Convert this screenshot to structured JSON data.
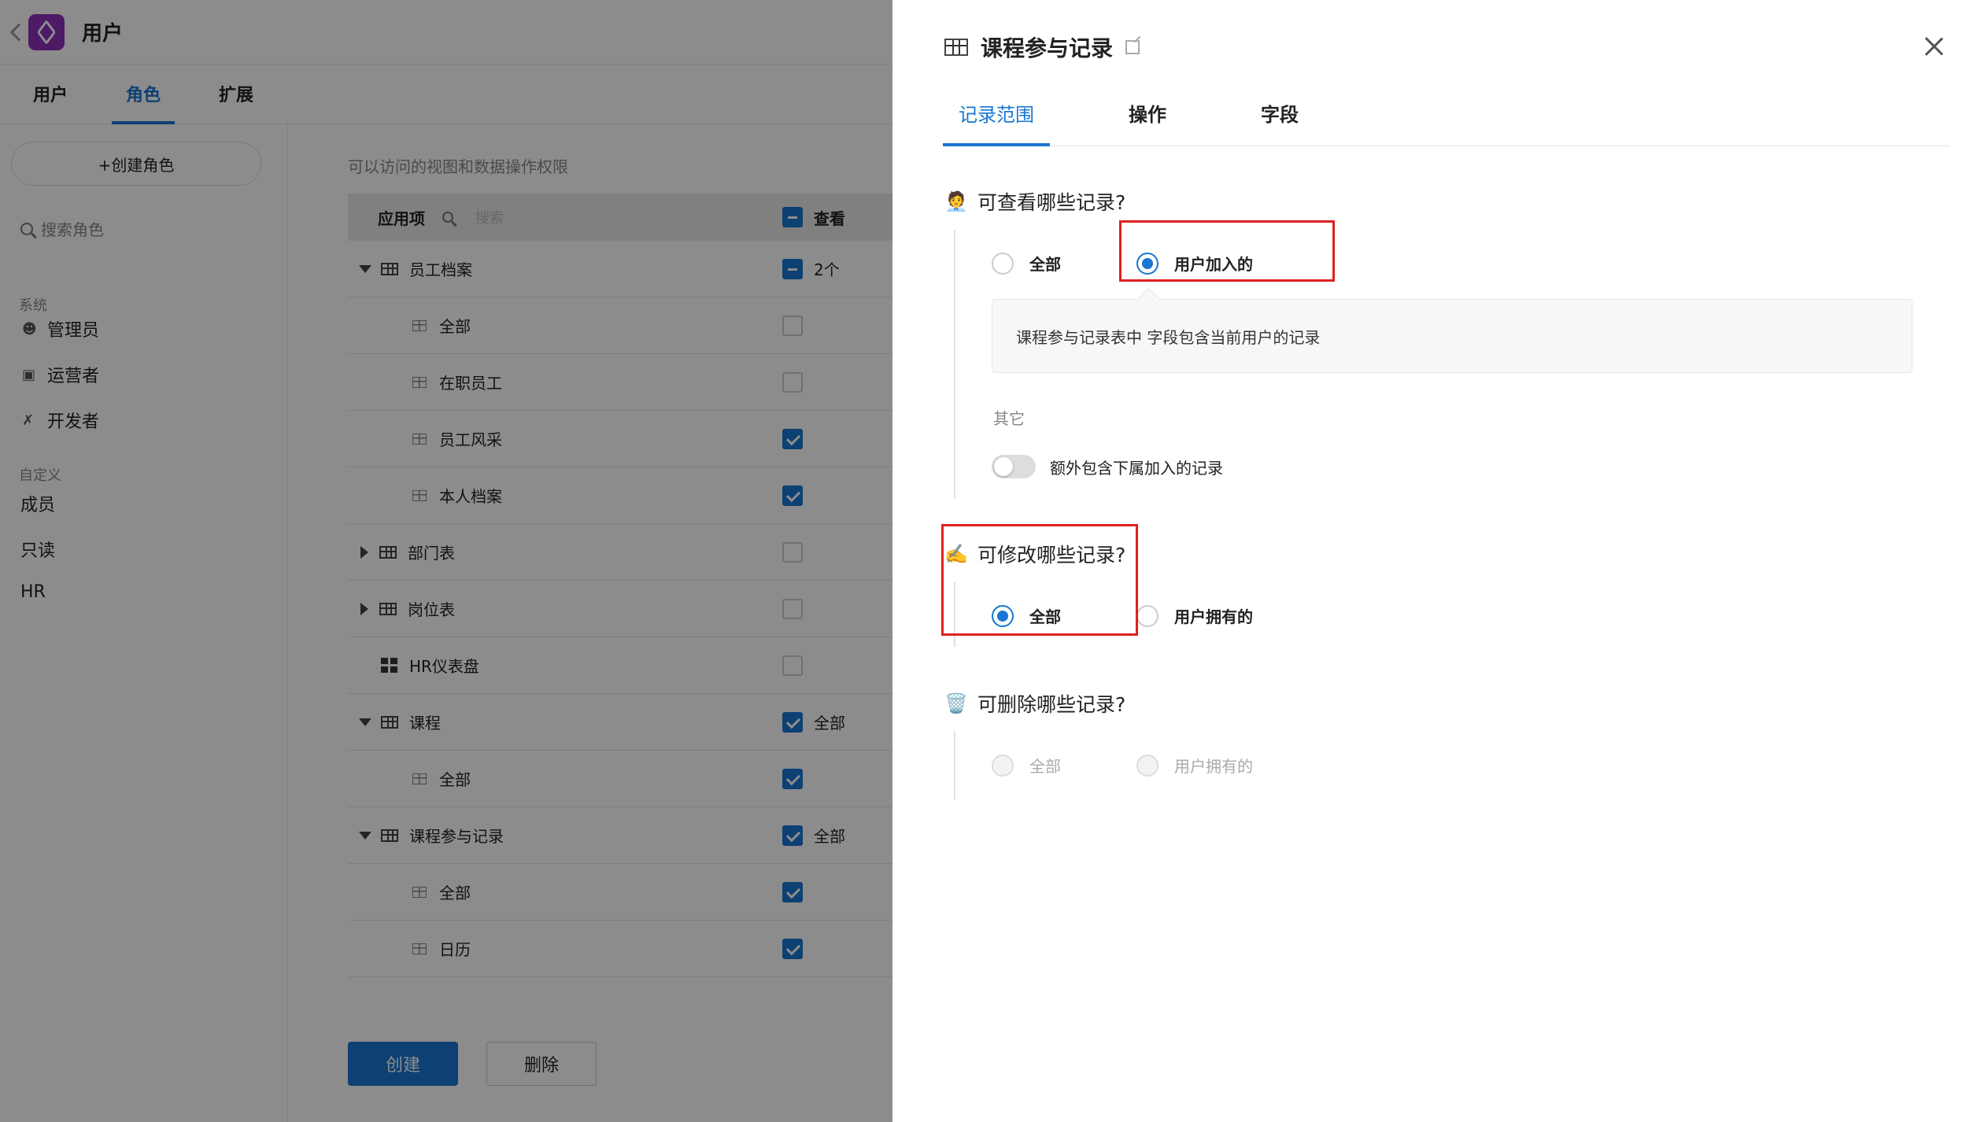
{
  "app": {
    "title": "用户",
    "tabs": [
      "用户",
      "角色",
      "扩展"
    ],
    "active_tab": 1
  },
  "sidebar": {
    "create_label": "+创建角色",
    "search_placeholder": "搜索角色",
    "system_label": "系统",
    "system_items": [
      "管理员",
      "运营者",
      "开发者"
    ],
    "custom_label": "自定义",
    "custom_items": [
      "成员",
      "只读",
      "HR"
    ]
  },
  "permissions": {
    "caption": "可以访问的视图和数据操作权限",
    "header": {
      "col1": "应用项",
      "search_placeholder": "搜索",
      "col2": "查看"
    },
    "rows": [
      {
        "label": "员工档案",
        "level": 0,
        "expand": "down",
        "icon": "table",
        "check": "partial",
        "note": "2个"
      },
      {
        "label": "全部",
        "level": 1,
        "icon": "view",
        "check": "none",
        "note": ""
      },
      {
        "label": "在职员工",
        "level": 1,
        "icon": "view",
        "check": "none",
        "note": ""
      },
      {
        "label": "员工风采",
        "level": 1,
        "icon": "view",
        "check": "checked",
        "note": ""
      },
      {
        "label": "本人档案",
        "level": 1,
        "icon": "view",
        "check": "checked",
        "note": ""
      },
      {
        "label": "部门表",
        "level": 0,
        "expand": "right",
        "icon": "table",
        "check": "none",
        "note": ""
      },
      {
        "label": "岗位表",
        "level": 0,
        "expand": "right",
        "icon": "table",
        "check": "none",
        "note": ""
      },
      {
        "label": "HR仪表盘",
        "level": 0,
        "expand": "none",
        "icon": "dashboard",
        "check": "none",
        "note": ""
      },
      {
        "label": "课程",
        "level": 0,
        "expand": "down",
        "icon": "table",
        "check": "checked",
        "note": "全部"
      },
      {
        "label": "全部",
        "level": 1,
        "icon": "view",
        "check": "checked",
        "note": ""
      },
      {
        "label": "课程参与记录",
        "level": 0,
        "expand": "down",
        "icon": "table",
        "check": "checked",
        "note": "全部"
      },
      {
        "label": "全部",
        "level": 1,
        "icon": "view",
        "check": "checked",
        "note": ""
      },
      {
        "label": "日历",
        "level": 1,
        "icon": "calendar",
        "check": "checked",
        "note": ""
      }
    ],
    "create_button": "创建",
    "delete_button": "删除"
  },
  "drawer": {
    "title": "课程参与记录",
    "tabs": [
      "记录范围",
      "操作",
      "字段"
    ],
    "active_tab": 0,
    "view_section": {
      "title": "可查看哪些记录?",
      "emoji": "🧑‍💼",
      "options": [
        "全部",
        "用户加入的"
      ],
      "selected": 1,
      "description": "课程参与记录表中 字段包含当前用户的记录",
      "other_label": "其它",
      "toggle_label": "额外包含下属加入的记录",
      "toggle_on": false
    },
    "edit_section": {
      "title": "可修改哪些记录?",
      "emoji": "✍️",
      "options": [
        "全部",
        "用户拥有的"
      ],
      "selected": 0
    },
    "delete_section": {
      "title": "可删除哪些记录?",
      "emoji": "🗑️",
      "options": [
        "全部",
        "用户拥有的"
      ],
      "selected": -1,
      "disabled": true
    }
  },
  "colors": {
    "accent": "#1976d2",
    "highlight": "#e02020",
    "logo": "#8e2eb8"
  }
}
